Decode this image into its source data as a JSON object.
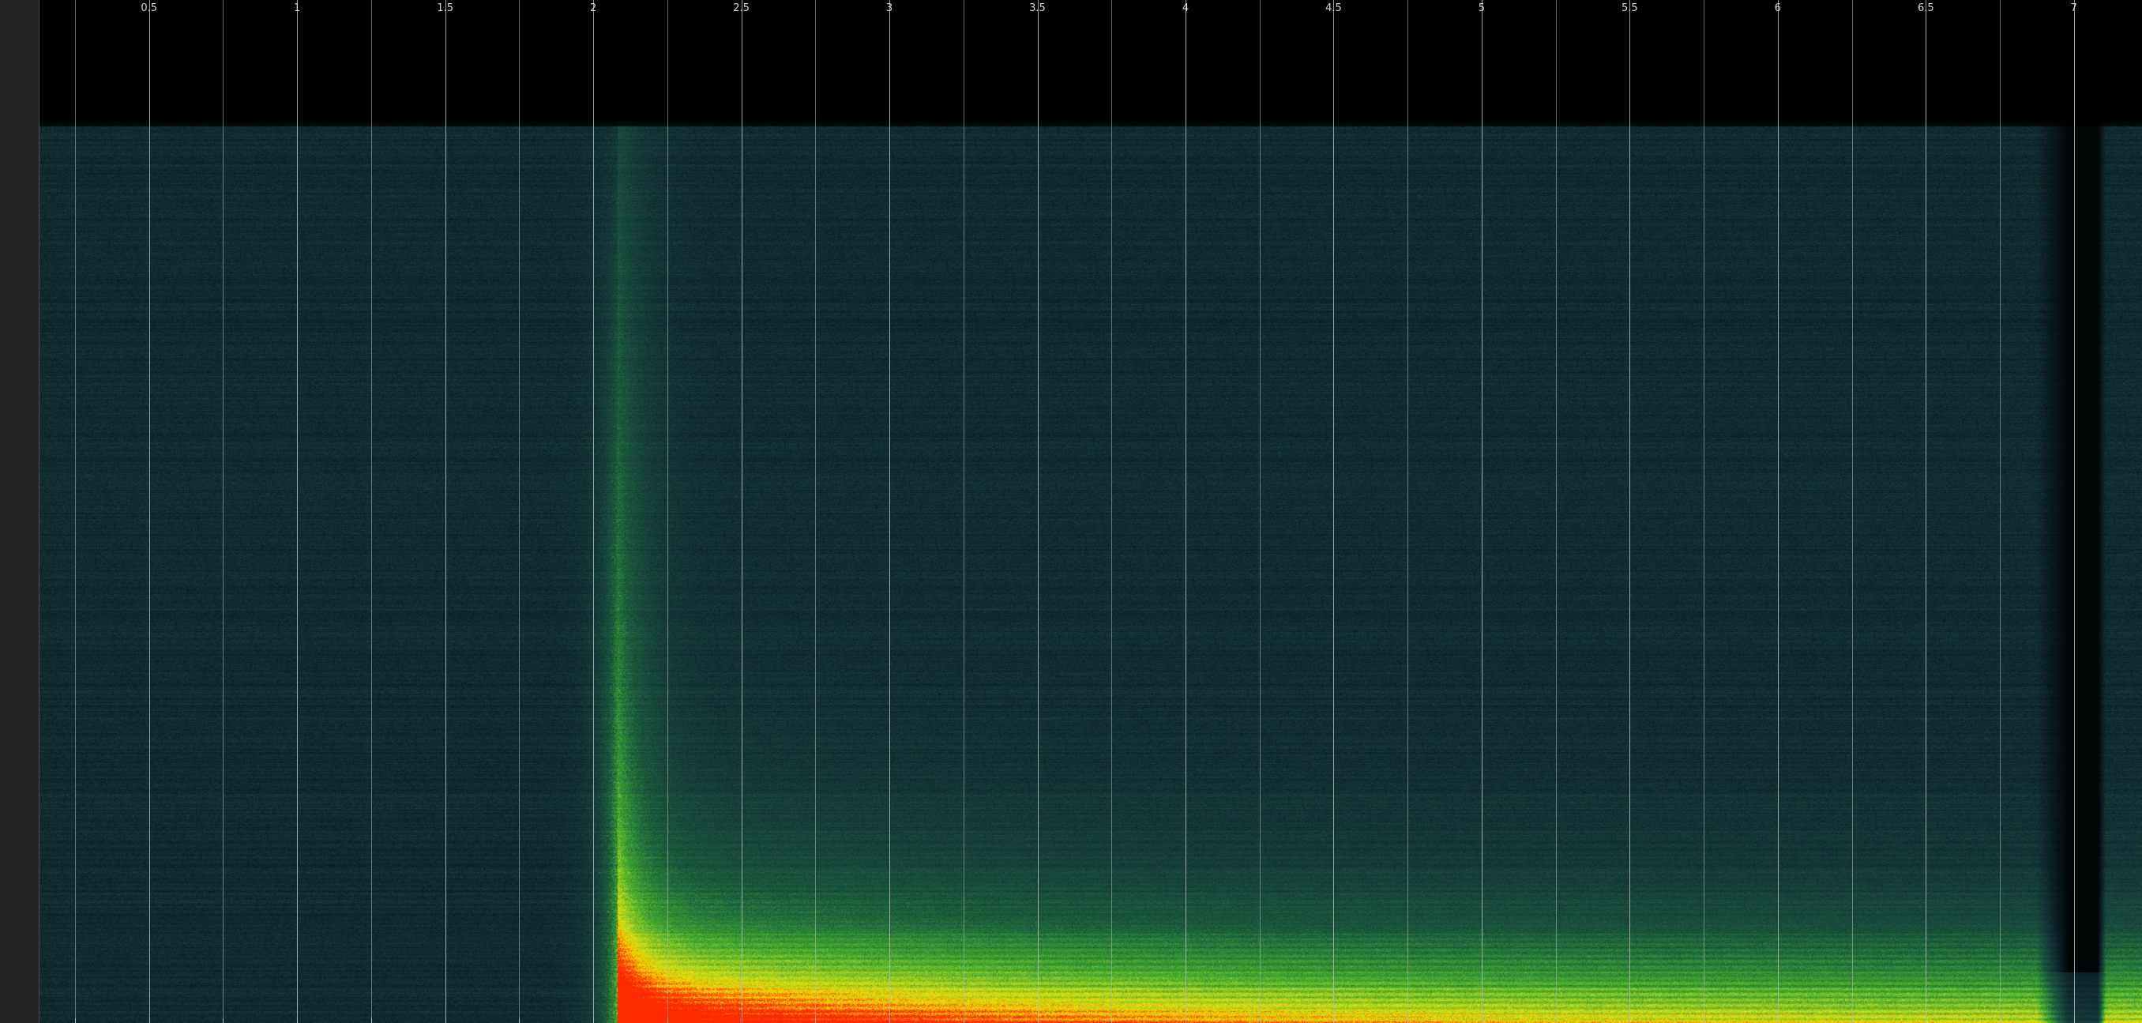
{
  "view": {
    "kind": "spectrogram",
    "colormap": [
      "#000000",
      "#0a1a1e",
      "#123336",
      "#1c5c3e",
      "#3fa830",
      "#b6d61e",
      "#f0e000",
      "#ff7a00",
      "#ff2a00"
    ],
    "background": "#000000",
    "grid_color": "#b4b8ba",
    "panel_color": "#222323"
  },
  "timeline": {
    "visible_range_seconds": [
      0.13,
      7.23
    ],
    "major_tick_labels": [
      "0.5",
      "1",
      "1.5",
      "2",
      "2.5",
      "3",
      "3.5",
      "4",
      "4.5",
      "5",
      "5.5",
      "6",
      "6.5",
      "7"
    ],
    "major_tick_values": [
      0.5,
      1,
      1.5,
      2,
      2.5,
      3,
      3.5,
      4,
      4.5,
      5,
      5.5,
      6,
      6.5,
      7
    ],
    "minor_tick_interval": 0.25
  },
  "spectrogram": {
    "onset_seconds": 2.08,
    "silence_gap_seconds": [
      6.98,
      7.08
    ],
    "low_band_intensity": 0.95,
    "floor_intensity": 0.22
  }
}
